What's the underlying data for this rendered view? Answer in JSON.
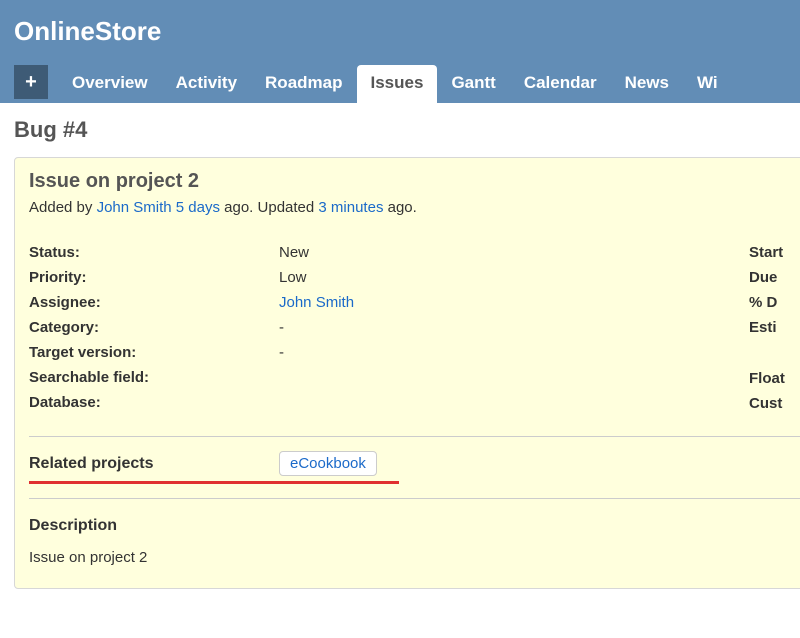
{
  "header": {
    "project_title": "OnlineStore"
  },
  "tabs": {
    "plus": "+",
    "items": [
      {
        "label": "Overview",
        "active": false
      },
      {
        "label": "Activity",
        "active": false
      },
      {
        "label": "Roadmap",
        "active": false
      },
      {
        "label": "Issues",
        "active": true
      },
      {
        "label": "Gantt",
        "active": false
      },
      {
        "label": "Calendar",
        "active": false
      },
      {
        "label": "News",
        "active": false
      },
      {
        "label": "Wi",
        "active": false
      }
    ]
  },
  "page": {
    "heading": "Bug #4"
  },
  "issue": {
    "title": "Issue on project 2",
    "meta": {
      "added_by_prefix": "Added by ",
      "author": "John Smith",
      "author_ago": "5 days",
      "ago_suffix1": " ago. Updated ",
      "updated_ago": "3 minutes",
      "ago_suffix2": " ago."
    },
    "left_attrs": {
      "status_label": "Status:",
      "status_value": "New",
      "priority_label": "Priority:",
      "priority_value": "Low",
      "assignee_label": "Assignee:",
      "assignee_value": "John Smith",
      "category_label": "Category:",
      "category_value": "-",
      "target_version_label": "Target version:",
      "target_version_value": "-",
      "searchable_label": "Searchable field:",
      "searchable_value": "",
      "database_label": "Database:",
      "database_value": ""
    },
    "right_attrs": {
      "start_label": "Start",
      "due_label": "Due ",
      "percent_label": "% D",
      "estim_label": "Esti",
      "float_label": "Float",
      "cust_label": "Cust"
    },
    "related": {
      "label": "Related projects",
      "tag": "eCookbook"
    },
    "description_heading": "Description",
    "description_text": "Issue on project 2"
  }
}
